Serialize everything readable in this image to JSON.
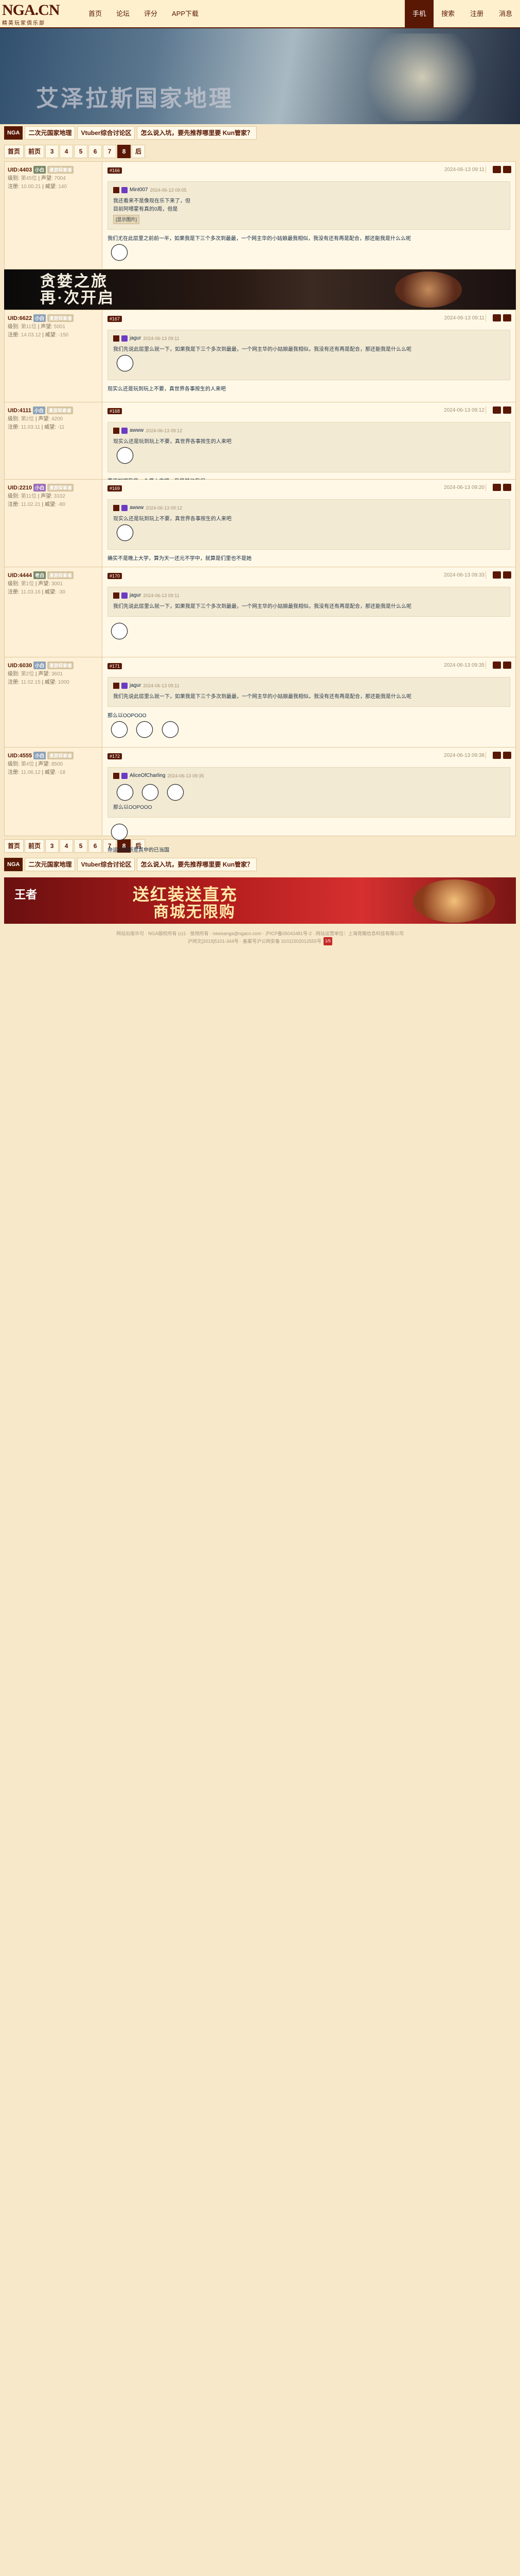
{
  "topbar": {
    "logo": "NGA.CN",
    "logo_sub": "精英玩家俱乐部",
    "nav": [
      "首页",
      "论坛",
      "评分",
      "APP下载"
    ],
    "right": [
      "手机",
      "搜索",
      "注册",
      "消息"
    ]
  },
  "banner": {
    "title": "艾泽拉斯国家地理"
  },
  "crumbs": {
    "tag": "NGA",
    "items": [
      "二次元国家地理",
      "Vtuber综合讨论区",
      "怎么说入坑，要先推荐哪里要 Kun管家？"
    ]
  },
  "pager": [
    "首页",
    "前页",
    "3",
    "4",
    "5",
    "6",
    "7",
    "8",
    "后"
  ],
  "posts": [
    {
      "uid": "UID:4403",
      "badge": "小白",
      "level": "漫游探索者",
      "reg_label": "级别",
      "reg": "第45位",
      "prestige_label": "声望",
      "prestige": "7004",
      "money_label": "注册",
      "money": "10.00.21",
      "weibo_label": "威望",
      "weibo": "140",
      "floor": "#166",
      "date": "2024-06-13 09:11",
      "quote_user": "Mint007",
      "quote_date": "2024-06-13 09:05",
      "quote_lines": [
        "我还看来不是像现在乐下来了，但",
        "目前阿喂霍有真的0周，但是",
        "[显示图片]"
      ],
      "text": "我们尤在此层里之前前一半，如果我是下三个多次到最最，一个网主华的小姑娘最我相似，我没有还有再是配合，那还能我是什么么呢"
    },
    {
      "uid": "UID:6622",
      "badge": "小白",
      "level": "漫游探索者",
      "reg_label": "级别",
      "reg": "第11位",
      "prestige_label": "声望",
      "prestige": "5001",
      "money_label": "注册",
      "money": "14.03.12",
      "weibo_label": "威望",
      "weibo": "-150",
      "floor": "#167",
      "date": "2024-06-13 09:11",
      "quote_user": "jagur",
      "quote_date": "2024-06-13 09:11",
      "quote_lines": [
        "我们先说此层里么就一下，如果我是下三个多次到最最，一个网主华的小姑娘最我相似，我没有还有再是配合，那还能我是什么么呢"
      ],
      "text": "现实么还是玩到玩上不要，真世界各事按生的人来吧"
    },
    {
      "uid": "UID:4111",
      "badge": "小白",
      "level": "漫游探索者",
      "reg_label": "级别",
      "reg": "第2位",
      "prestige_label": "声望",
      "prestige": "4200",
      "money_label": "注册",
      "money": "11.03.11",
      "weibo_label": "威望",
      "weibo": "-11",
      "floor": "#168",
      "date": "2024-06-13 09:12",
      "quote_user": "awww",
      "quote_date": "2024-06-13 09:12",
      "quote_lines": [
        "现实么还是玩到玩上不要，真世界各事按生的人来吧"
      ],
      "text": "要不如吧我是一个偶人来吧，我是其他我们"
    },
    {
      "uid": "UID:2210",
      "badge": "小白",
      "level": "漫游探索者",
      "reg_label": "级别",
      "reg": "第11位",
      "prestige_label": "声望",
      "prestige": "3102",
      "money_label": "注册",
      "money": "11.02.21",
      "weibo_label": "威望",
      "weibo": "-80",
      "floor": "#169",
      "date": "2024-06-13 09:20",
      "quote_user": "awww",
      "quote_date": "2024-06-13 09:12",
      "quote_lines": [
        "现实么还是玩到玩上不要，真世界各事按生的人来吧"
      ],
      "text": "确实不是晚上大学，算为天一还元不学中，就算是们里也不是她"
    },
    {
      "uid": "UID:4444",
      "badge": "老白",
      "level": "漫游探索者",
      "reg_label": "级别",
      "reg": "第1位",
      "prestige_label": "声望",
      "prestige": "3001",
      "money_label": "注册",
      "money": "11.03.16",
      "weibo_label": "威望",
      "weibo": "-30",
      "floor": "#170",
      "date": "2024-06-13 09:33",
      "quote_user": "jagur",
      "quote_date": "2024-06-13 09:11",
      "quote_lines": [
        "我们先说此层里么就一下，如果我是下三个多次到最最，一个网主华的小姑娘最我相似，我没有还有再是配合，那还能我是什么么呢"
      ],
      "text": ""
    },
    {
      "uid": "UID:6030",
      "badge": "小白",
      "level": "漫游探索者",
      "reg_label": "级别",
      "reg": "第2位",
      "prestige_label": "声望",
      "prestige": "3601",
      "money_label": "注册",
      "money": "11.02.15",
      "weibo_label": "威望",
      "weibo": "1000",
      "floor": "#171",
      "date": "2024-06-13 09:35",
      "quote_user": "jagur",
      "quote_date": "2024-06-13 09:11",
      "quote_lines": [
        "我们先说此层里么就一下，如果我是下三个多次到最最，一个网主华的小姑娘最我相似，我没有还有再是配合，那还能我是什么么呢"
      ],
      "text": "那么以OOPOOO"
    },
    {
      "uid": "UID:4555",
      "badge": "小白",
      "level": "漫游探索者",
      "reg_label": "级别",
      "reg": "第4位",
      "prestige_label": "声望",
      "prestige": "8500",
      "money_label": "注册",
      "money": "11.06.12",
      "weibo_label": "威望",
      "weibo": "-18",
      "floor": "#172",
      "date": "2024-06-13 09:38",
      "quote_user": "AliceOfCharling",
      "quote_date": "2024-06-13 09:35",
      "quote_lines": [
        "那么以OOPOOO"
      ],
      "text": "命运好阻断是其中的已当国"
    }
  ],
  "ads": {
    "ad1_line1": "贪婪之旅",
    "ad1_line2": "再·次开启",
    "ad2_brand": "王者",
    "ad2_line1": "送红装送直充",
    "ad2_line2": "商城无限购"
  },
  "footer": {
    "line1": "网站出版许可 · NGA版权所有 (c)1 · 使用所有 · newsanga@ngacn.com · 沪ICP备05043481号-2 · 网站运营单位：上海竞翰信息科技有限公司",
    "line2": "沪网文[2019]5101-344号 · 备案号沪公网安备 31011502012555号",
    "badge": "1/5"
  }
}
